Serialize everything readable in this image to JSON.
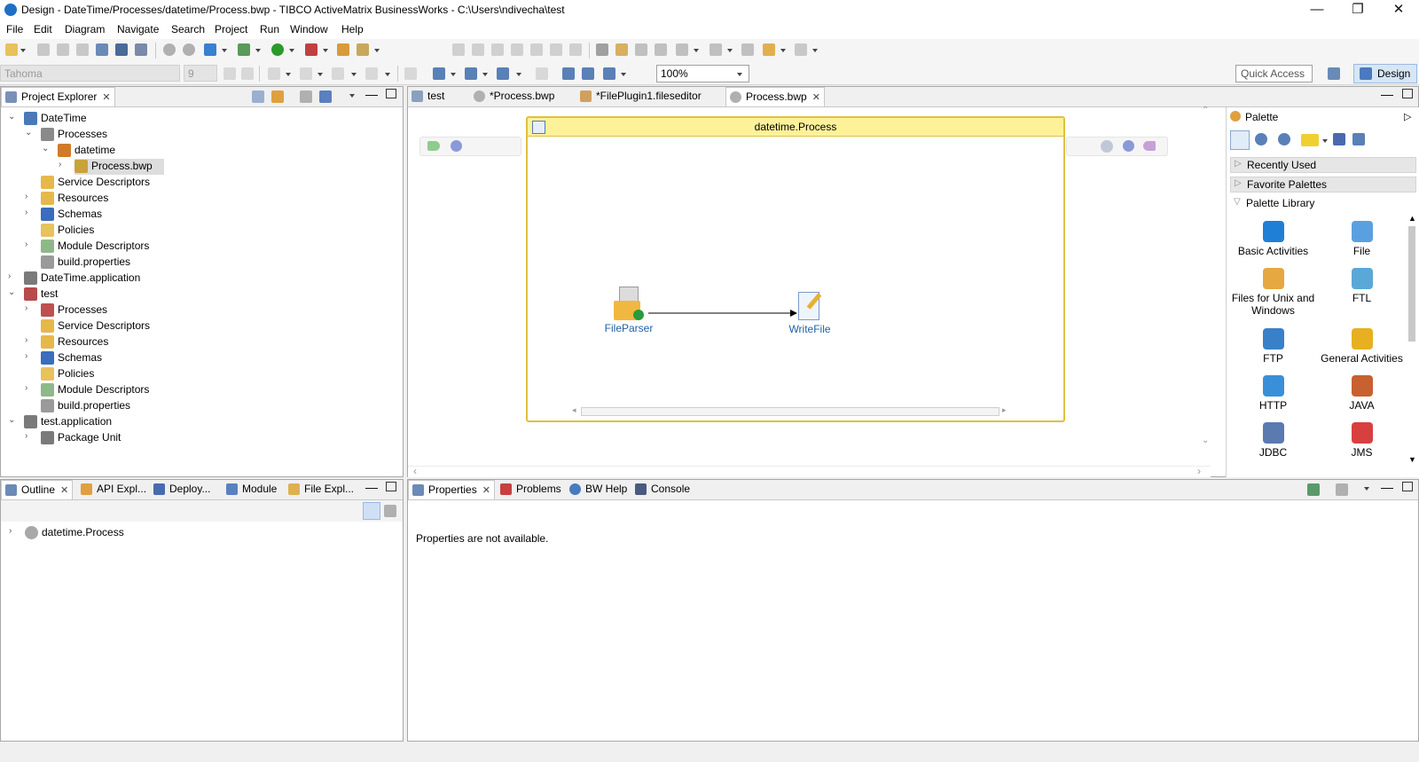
{
  "window": {
    "title": "Design - DateTime/Processes/datetime/Process.bwp - TIBCO ActiveMatrix BusinessWorks - C:\\Users\\ndivecha\\test",
    "controls": [
      "—",
      "❐",
      "✕"
    ]
  },
  "menu": [
    "File",
    "Edit",
    "Diagram",
    "Navigate",
    "Search",
    "Project",
    "Run",
    "Window",
    "Help"
  ],
  "toolbar": {
    "font": "Tahoma",
    "font_size": "9",
    "zoom": "100%",
    "quick_access": "Quick Access",
    "perspective": "Design"
  },
  "project_explorer": {
    "tab": "Project Explorer",
    "tree": [
      {
        "label": "DateTime",
        "twisty": "⌄",
        "icon": "application-project-icon",
        "color": "#4a78b8"
      },
      {
        "label": "Processes",
        "twisty": "⌄",
        "icon": "processes-folder-icon",
        "color": "#8a8a8a"
      },
      {
        "label": "datetime",
        "twisty": "⌄",
        "icon": "package-icon",
        "color": "#d07a2a"
      },
      {
        "label": "Process.bwp",
        "twisty": "›",
        "icon": "process-file-icon",
        "color": "#c9a23a",
        "selected": true
      },
      {
        "label": "Service Descriptors",
        "twisty": "",
        "icon": "service-descriptors-folder-icon",
        "color": "#e6b84a"
      },
      {
        "label": "Resources",
        "twisty": "›",
        "icon": "resources-folder-icon",
        "color": "#e6b84a"
      },
      {
        "label": "Schemas",
        "twisty": "›",
        "icon": "schemas-folder-icon",
        "color": "#3a6cc0"
      },
      {
        "label": "Policies",
        "twisty": "",
        "icon": "policies-icon",
        "color": "#e8c25a"
      },
      {
        "label": "Module Descriptors",
        "twisty": "›",
        "icon": "module-descriptors-icon",
        "color": "#8fb88a"
      },
      {
        "label": "build.properties",
        "twisty": "",
        "icon": "properties-file-icon",
        "color": "#9a9a9a"
      },
      {
        "label": "DateTime.application",
        "twisty": "›",
        "icon": "application-icon",
        "color": "#7a7a7a"
      },
      {
        "label": "test",
        "twisty": "⌄",
        "icon": "module-error-icon",
        "color": "#b84a4a"
      },
      {
        "label": "Processes",
        "twisty": "›",
        "icon": "processes-folder-error-icon",
        "color": "#c05050"
      },
      {
        "label": "Service Descriptors",
        "twisty": "",
        "icon": "service-descriptors-folder-icon",
        "color": "#e6b84a"
      },
      {
        "label": "Resources",
        "twisty": "›",
        "icon": "resources-folder-icon",
        "color": "#e6b84a"
      },
      {
        "label": "Schemas",
        "twisty": "›",
        "icon": "schemas-folder-icon",
        "color": "#3a6cc0"
      },
      {
        "label": "Policies",
        "twisty": "",
        "icon": "policies-icon",
        "color": "#e8c25a"
      },
      {
        "label": "Module Descriptors",
        "twisty": "›",
        "icon": "module-descriptors-icon",
        "color": "#8fb88a"
      },
      {
        "label": "build.properties",
        "twisty": "",
        "icon": "properties-file-icon",
        "color": "#9a9a9a"
      },
      {
        "label": "test.application",
        "twisty": "⌄",
        "icon": "application-icon",
        "color": "#7a7a7a"
      },
      {
        "label": "Package Unit",
        "twisty": "›",
        "icon": "package-unit-icon",
        "color": "#7a7a7a"
      }
    ]
  },
  "editor": {
    "tabs": [
      {
        "label": "test",
        "icon": "module-icon"
      },
      {
        "label": "*Process.bwp",
        "icon": "process-icon"
      },
      {
        "label": "*FilePlugin1.fileseditor",
        "icon": "file-editor-icon"
      },
      {
        "label": "Process.bwp",
        "icon": "process-icon",
        "active": true
      }
    ],
    "process_title": "datetime.Process",
    "activities": [
      {
        "label": "FileParser",
        "icon": "file-parser-icon"
      },
      {
        "label": "WriteFile",
        "icon": "write-file-icon"
      }
    ]
  },
  "palette": {
    "title": "Palette",
    "sections": [
      "Recently Used",
      "Favorite Palettes",
      "Palette Library"
    ],
    "items": [
      {
        "label": "Basic Activities",
        "icon": "basic-activities-icon",
        "color": "#1f7fd6"
      },
      {
        "label": "File",
        "icon": "file-icon",
        "color": "#5aa0e0"
      },
      {
        "label": "Files for Unix and Windows",
        "icon": "files-unix-windows-icon",
        "color": "#e6a840"
      },
      {
        "label": "FTL",
        "icon": "ftl-icon",
        "color": "#5aa8d8"
      },
      {
        "label": "FTP",
        "icon": "ftp-icon",
        "color": "#3a80c8"
      },
      {
        "label": "General Activities",
        "icon": "general-activities-icon",
        "color": "#e6b020"
      },
      {
        "label": "HTTP",
        "icon": "http-globe-icon",
        "color": "#3a90d8"
      },
      {
        "label": "JAVA",
        "icon": "java-cup-icon",
        "color": "#c86030"
      },
      {
        "label": "JDBC",
        "icon": "jdbc-database-icon",
        "color": "#5a7ab0"
      },
      {
        "label": "JMS",
        "icon": "jms-cup-icon",
        "color": "#d84040"
      }
    ]
  },
  "outline": {
    "tabs": [
      "Outline",
      "API Expl...",
      "Deploy...",
      "Module",
      "File Expl..."
    ],
    "item": "datetime.Process"
  },
  "properties": {
    "tabs": [
      "Properties",
      "Problems",
      "BW Help",
      "Console"
    ],
    "message": "Properties are not available."
  }
}
